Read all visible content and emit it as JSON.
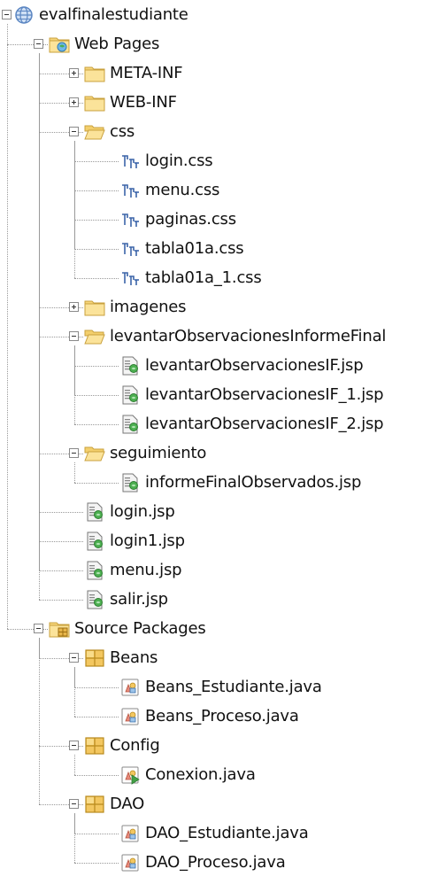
{
  "tree": {
    "nodes": [
      {
        "label": "evalfinalestudiante",
        "icon": "globe-icon",
        "depth": 0,
        "toggle": "minus",
        "name": "tree-node-project"
      },
      {
        "label": "Web Pages",
        "icon": "web-folder-icon",
        "depth": 1,
        "toggle": "minus",
        "name": "tree-node-web-pages"
      },
      {
        "label": "META-INF",
        "icon": "folder-icon",
        "depth": 2,
        "toggle": "plus",
        "name": "tree-node-meta-inf"
      },
      {
        "label": "WEB-INF",
        "icon": "folder-icon",
        "depth": 2,
        "toggle": "plus",
        "name": "tree-node-web-inf"
      },
      {
        "label": "css",
        "icon": "folder-open-icon",
        "depth": 2,
        "toggle": "minus",
        "name": "tree-node-css"
      },
      {
        "label": "login.css",
        "icon": "css-file-icon",
        "depth": 3,
        "toggle": null,
        "name": "tree-node-login-css"
      },
      {
        "label": "menu.css",
        "icon": "css-file-icon",
        "depth": 3,
        "toggle": null,
        "name": "tree-node-menu-css"
      },
      {
        "label": "paginas.css",
        "icon": "css-file-icon",
        "depth": 3,
        "toggle": null,
        "name": "tree-node-paginas-css"
      },
      {
        "label": "tabla01a.css",
        "icon": "css-file-icon",
        "depth": 3,
        "toggle": null,
        "name": "tree-node-tabla01a-css"
      },
      {
        "label": "tabla01a_1.css",
        "icon": "css-file-icon",
        "depth": 3,
        "toggle": null,
        "name": "tree-node-tabla01a-1-css"
      },
      {
        "label": "imagenes",
        "icon": "folder-icon",
        "depth": 2,
        "toggle": "plus",
        "name": "tree-node-imagenes"
      },
      {
        "label": "levantarObservacionesInformeFinal",
        "icon": "folder-open-icon",
        "depth": 2,
        "toggle": "minus",
        "name": "tree-node-levantar-folder"
      },
      {
        "label": "levantarObservacionesIF.jsp",
        "icon": "jsp-file-icon",
        "depth": 3,
        "toggle": null,
        "name": "tree-node-levantar-if-jsp"
      },
      {
        "label": "levantarObservacionesIF_1.jsp",
        "icon": "jsp-file-icon",
        "depth": 3,
        "toggle": null,
        "name": "tree-node-levantar-if-1-jsp"
      },
      {
        "label": "levantarObservacionesIF_2.jsp",
        "icon": "jsp-file-icon",
        "depth": 3,
        "toggle": null,
        "name": "tree-node-levantar-if-2-jsp"
      },
      {
        "label": "seguimiento",
        "icon": "folder-open-icon",
        "depth": 2,
        "toggle": "minus",
        "name": "tree-node-seguimiento"
      },
      {
        "label": "informeFinalObservados.jsp",
        "icon": "jsp-file-icon",
        "depth": 3,
        "toggle": null,
        "name": "tree-node-informe-final-jsp"
      },
      {
        "label": "login.jsp",
        "icon": "jsp-file-icon",
        "depth": 2,
        "toggle": null,
        "name": "tree-node-login-jsp"
      },
      {
        "label": "login1.jsp",
        "icon": "jsp-file-icon",
        "depth": 2,
        "toggle": null,
        "name": "tree-node-login1-jsp"
      },
      {
        "label": "menu.jsp",
        "icon": "jsp-file-icon",
        "depth": 2,
        "toggle": null,
        "name": "tree-node-menu-jsp"
      },
      {
        "label": "salir.jsp",
        "icon": "jsp-file-icon",
        "depth": 2,
        "toggle": null,
        "name": "tree-node-salir-jsp"
      },
      {
        "label": "Source Packages",
        "icon": "source-folder-icon",
        "depth": 1,
        "toggle": "minus",
        "name": "tree-node-source-packages"
      },
      {
        "label": "Beans",
        "icon": "package-icon",
        "depth": 2,
        "toggle": "minus",
        "name": "tree-node-beans"
      },
      {
        "label": "Beans_Estudiante.java",
        "icon": "java-file-icon",
        "depth": 3,
        "toggle": null,
        "name": "tree-node-beans-estudiante"
      },
      {
        "label": "Beans_Proceso.java",
        "icon": "java-file-icon",
        "depth": 3,
        "toggle": null,
        "name": "tree-node-beans-proceso"
      },
      {
        "label": "Config",
        "icon": "package-icon",
        "depth": 2,
        "toggle": "minus",
        "name": "tree-node-config"
      },
      {
        "label": "Conexion.java",
        "icon": "java-main-file-icon",
        "depth": 3,
        "toggle": null,
        "name": "tree-node-conexion"
      },
      {
        "label": "DAO",
        "icon": "package-icon",
        "depth": 2,
        "toggle": "minus",
        "name": "tree-node-dao"
      },
      {
        "label": "DAO_Estudiante.java",
        "icon": "java-file-icon",
        "depth": 3,
        "toggle": null,
        "name": "tree-node-dao-estudiante"
      },
      {
        "label": "DAO_Proceso.java",
        "icon": "java-file-icon",
        "depth": 3,
        "toggle": null,
        "name": "tree-node-dao-proceso"
      }
    ]
  }
}
